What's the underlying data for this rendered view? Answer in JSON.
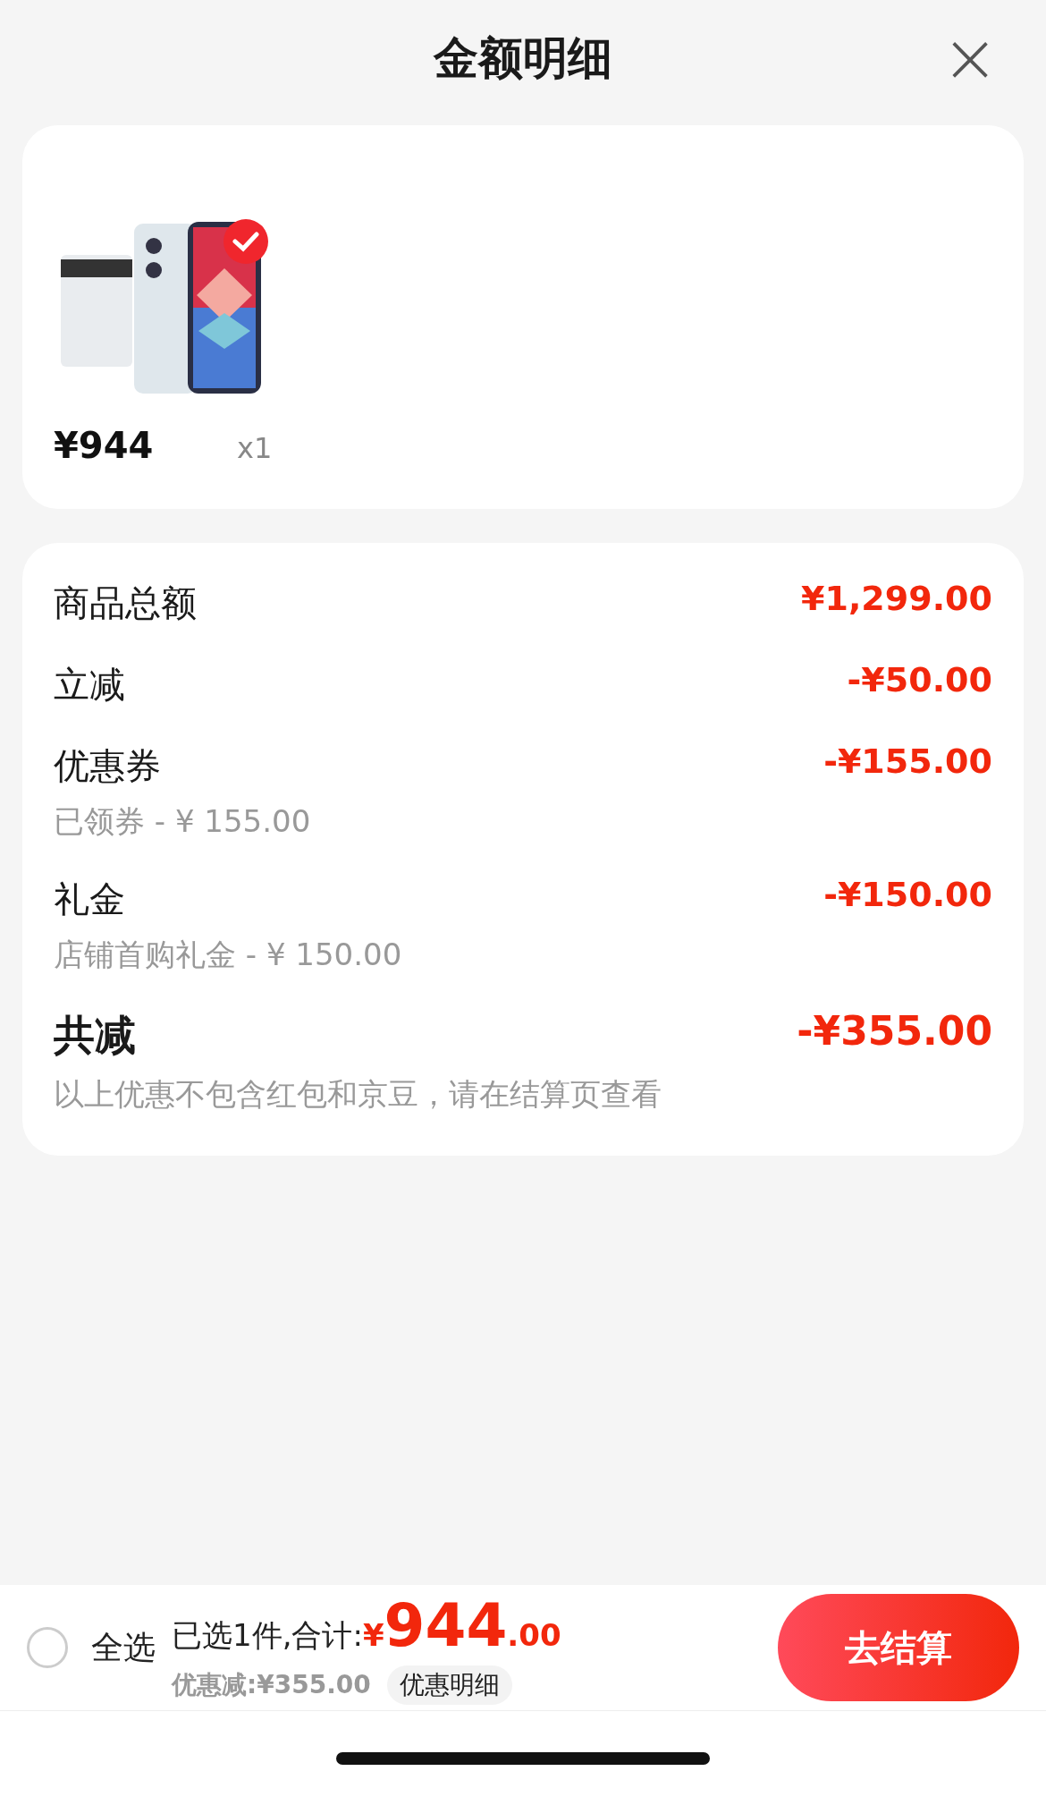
{
  "header": {
    "title": "金额明细",
    "close_label": "×"
  },
  "products": [
    {
      "kind": "picture",
      "selected": true,
      "price": "¥944",
      "quantity": "x1"
    }
  ],
  "breakdown": [
    {
      "label": "商品总额",
      "amount": "¥1,299.00",
      "emphasis": false
    },
    {
      "label": "立减",
      "amount": "-¥50.00",
      "emphasis": false
    },
    {
      "label": "优惠券",
      "amount": "-¥155.00",
      "detail": "已领券 - ¥ 155.00",
      "emphasis": false
    },
    {
      "label": "礼金",
      "amount": "-¥150.00",
      "detail": "店铺首购礼金 - ¥ 150.00",
      "emphasis": false
    },
    {
      "label": "共减",
      "amount": "-¥355.00",
      "detail": "以上优惠不包含红包和京豆，请在结算页查看",
      "emphasis": true
    }
  ],
  "footer": {
    "select_all": {
      "label": "全选",
      "checked": false
    },
    "summary": "已选1件,合计:",
    "currency": "¥",
    "total_integer": "944",
    "total_decimal": ".00",
    "discount": "优惠减:¥355.00",
    "details_button": "优惠明细",
    "checkout_button": "去结算"
  }
}
